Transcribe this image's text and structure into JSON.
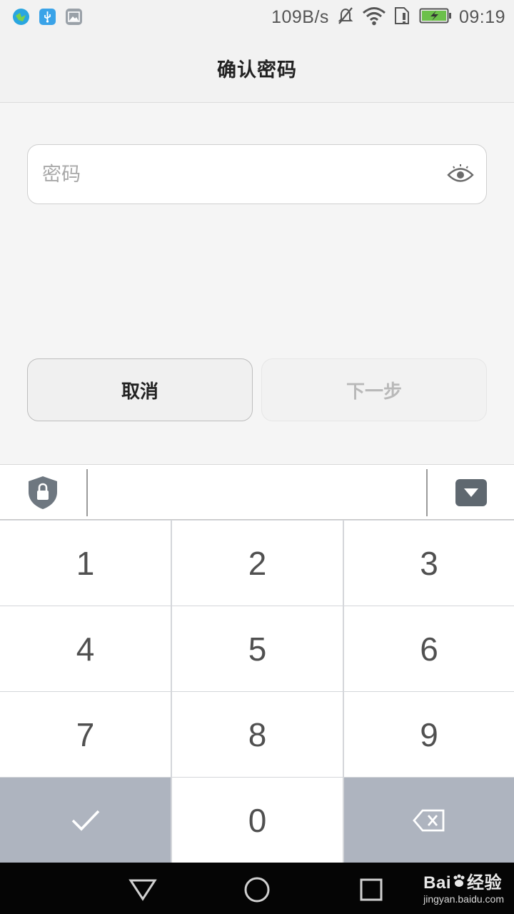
{
  "status_bar": {
    "net_speed": "109B/s",
    "time": "09:19",
    "icons": [
      "map-app-icon",
      "usb-icon",
      "gallery-icon",
      "mute-icon",
      "wifi-icon",
      "sim-alert-icon",
      "battery-charging-icon"
    ],
    "colors": {
      "map_app": "#2aa6e0",
      "usb": "#3aa3e8",
      "gallery": "#9aa1a8",
      "battery_fill": "#6cc04a"
    }
  },
  "header": {
    "title": "确认密码"
  },
  "password_field": {
    "placeholder": "密码",
    "value": "",
    "visibility_icon": "eye-icon"
  },
  "actions": {
    "cancel_label": "取消",
    "next_label": "下一步"
  },
  "keyboard": {
    "toolbar": {
      "left_icon": "shield-lock-icon",
      "right_icon": "hide-keyboard-icon"
    },
    "keys": [
      "1",
      "2",
      "3",
      "4",
      "5",
      "6",
      "7",
      "8",
      "9",
      "0"
    ],
    "confirm_icon": "checkmark-icon",
    "delete_icon": "backspace-icon",
    "colors": {
      "key_bg": "#ffffff",
      "special_key_bg": "#aeb4bf",
      "digit": "#505050"
    }
  },
  "nav_bar": {
    "buttons": [
      "back-icon",
      "home-icon",
      "recents-icon"
    ],
    "watermark": {
      "brand": "Bai",
      "brand_suffix": "经验",
      "url": "jingyan.baidu.com"
    }
  }
}
